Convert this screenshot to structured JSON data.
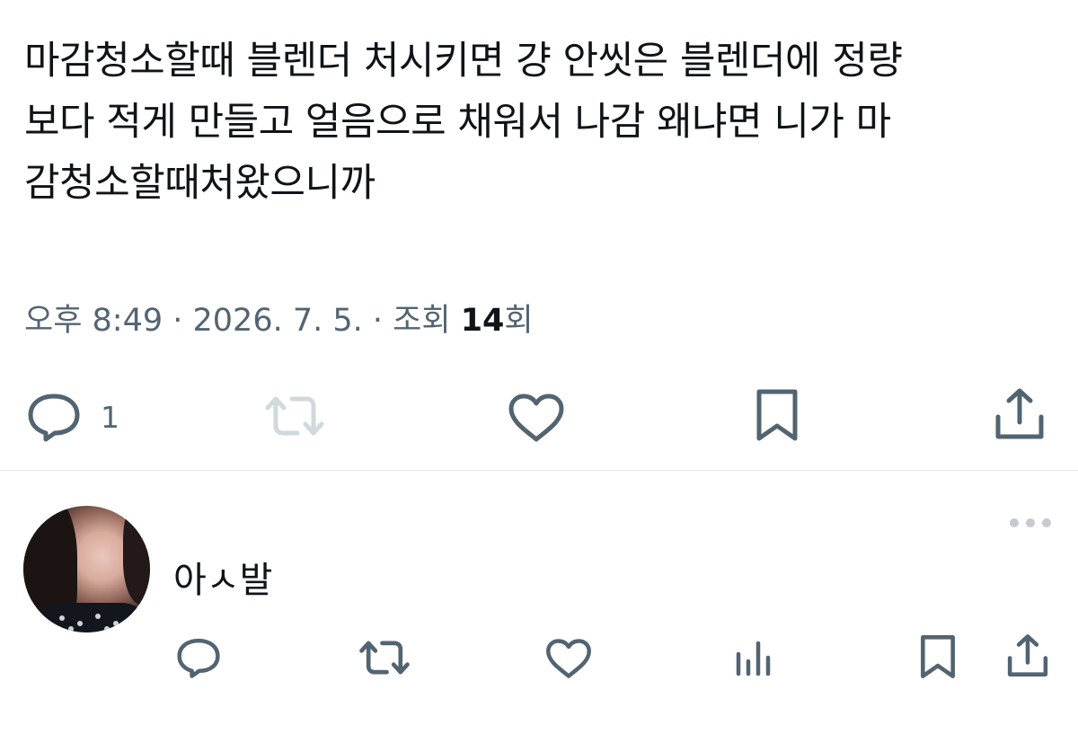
{
  "tweet": {
    "lines": [
      "마감청소할때 블렌더 처시키면 걍 안씻은 블렌더에 정량",
      "보다 적게 만들고 얼음으로 채워서 나감 왜냐면 니가 마",
      "감청소할때처왔으니까"
    ],
    "time": "오후 8:49",
    "date": "2026. 7. 5.",
    "separator": " · ",
    "views_prefix": "조회 ",
    "views_count": "14",
    "views_suffix": "회",
    "reply_count": "1"
  },
  "reply": {
    "text": "아ㅅ발"
  },
  "colors": {
    "text": "#0f1419",
    "secondary": "#536471",
    "muted_icon": "#cfd9de",
    "divider": "#e6e9ec"
  },
  "icons": {
    "tweet_actions": [
      "reply-icon",
      "retweet-icon",
      "like-icon",
      "bookmark-icon",
      "share-icon"
    ],
    "reply_actions": [
      "reply-icon",
      "retweet-icon",
      "like-icon",
      "views-icon",
      "bookmark-icon",
      "share-icon"
    ],
    "more": "more-icon"
  }
}
